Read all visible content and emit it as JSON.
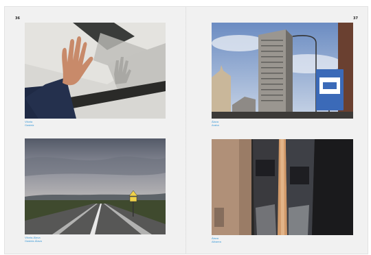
{
  "spread": {
    "left_page": {
      "page_number": "36",
      "photos": [
        {
          "icon": "photo-hand-on-wall",
          "caption": [
            "Vitoria",
            "Gasteiz"
          ]
        },
        {
          "icon": "photo-road-landscape",
          "caption": [
            "Vitoria-Álava",
            "Gasteiz-Álava"
          ]
        }
      ]
    },
    "right_page": {
      "page_number": "37",
      "photos": [
        {
          "icon": "photo-tower-bus-stop",
          "caption": [
            "Álava",
            "Araba"
          ]
        },
        {
          "icon": "photo-corridor",
          "caption": [
            "Álava",
            "Albarea"
          ]
        }
      ]
    }
  },
  "colors": {
    "caption": "#3b9ad8",
    "paper": "#f1f1f1"
  }
}
